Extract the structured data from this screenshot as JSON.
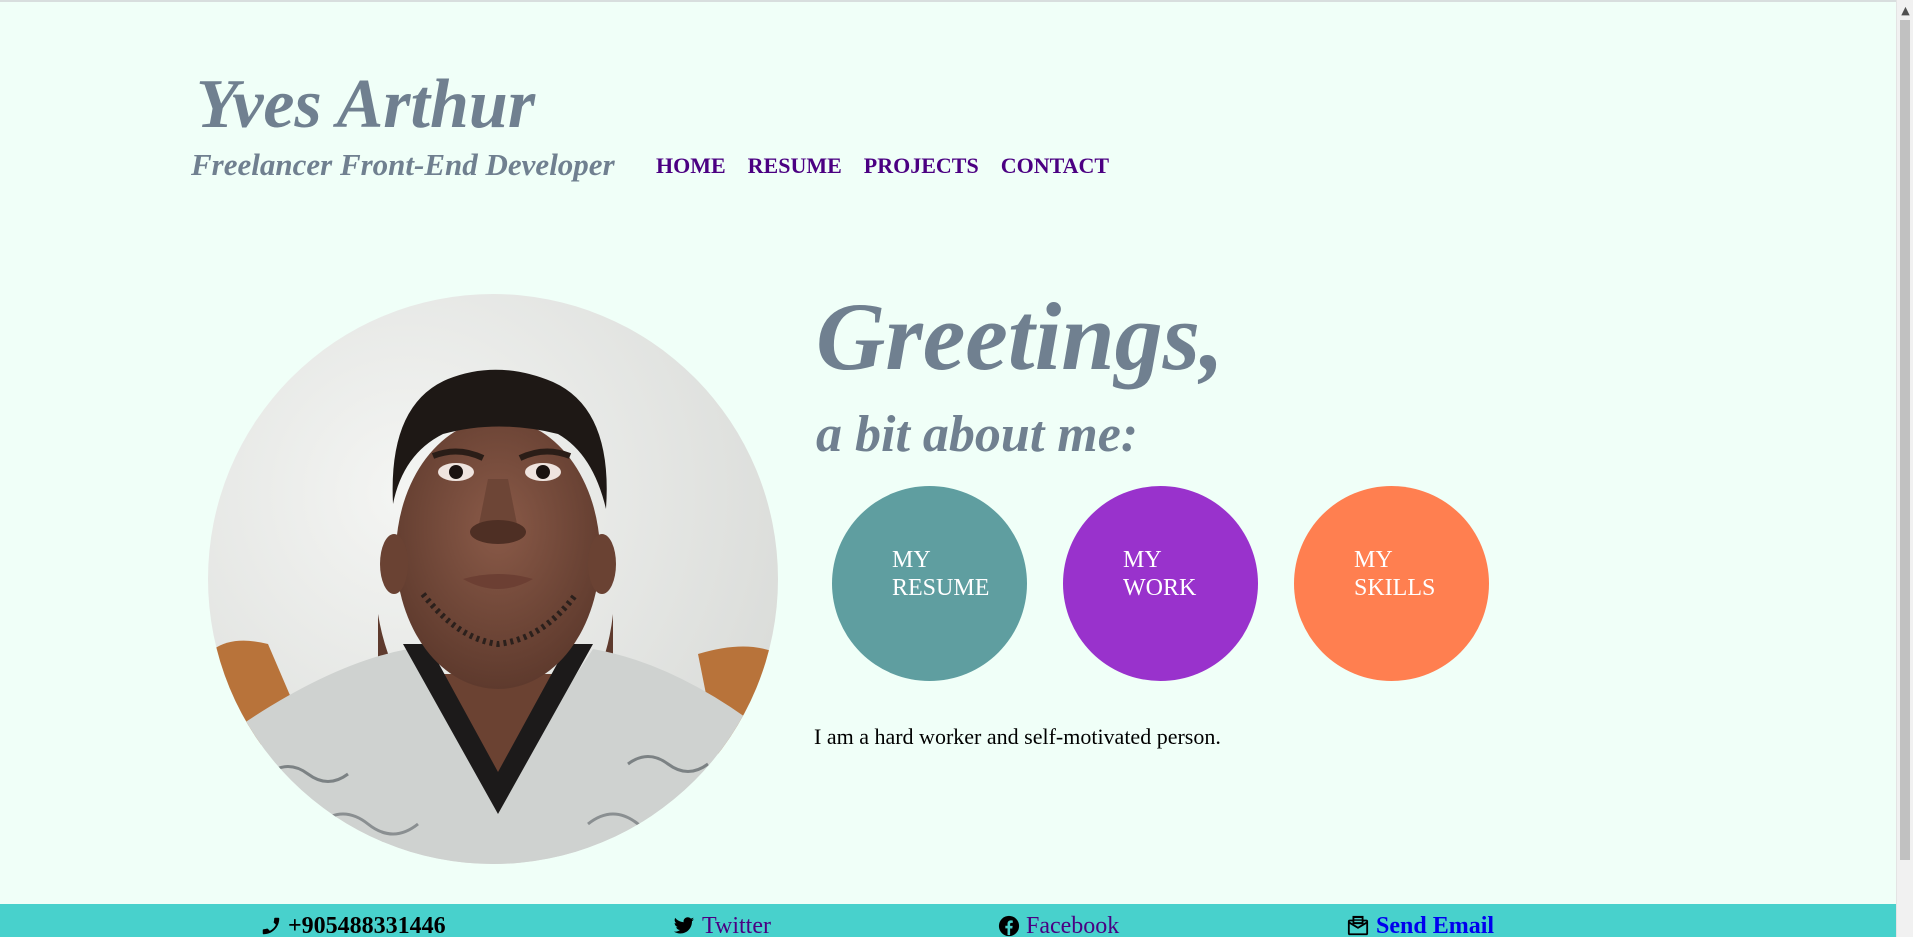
{
  "header": {
    "title": "Yves Arthur",
    "subtitle": "Freelancer Front-End Developer"
  },
  "nav": {
    "items": [
      {
        "label": "HOME"
      },
      {
        "label": "RESUME"
      },
      {
        "label": "PROJECTS"
      },
      {
        "label": "CONTACT"
      }
    ]
  },
  "hero": {
    "heading": "Greetings,",
    "subheading": "a bit about me:",
    "buttons": [
      {
        "line1": "MY",
        "line2": "RESUME",
        "color": "#5f9ea0"
      },
      {
        "line1": "MY",
        "line2": "WORK",
        "color": "#9932cc"
      },
      {
        "line1": "MY",
        "line2": "SKILLS",
        "color": "#ff7f50"
      }
    ],
    "intro": "I am a hard worker and self-motivated person.",
    "photo_icon": "profile-photo"
  },
  "footer": {
    "phone": {
      "icon": "phone-icon",
      "label": "+905488331446"
    },
    "twitter": {
      "icon": "twitter-icon",
      "label": "Twitter"
    },
    "facebook": {
      "icon": "facebook-icon",
      "label": "Facebook"
    },
    "email": {
      "icon": "envelope-icon",
      "label": "Send Email"
    }
  },
  "colors": {
    "background": "#f0fff8",
    "heading": "#708090",
    "nav_link": "#4b0082",
    "footer": "#48d1cc",
    "email_link": "#0000ee"
  }
}
